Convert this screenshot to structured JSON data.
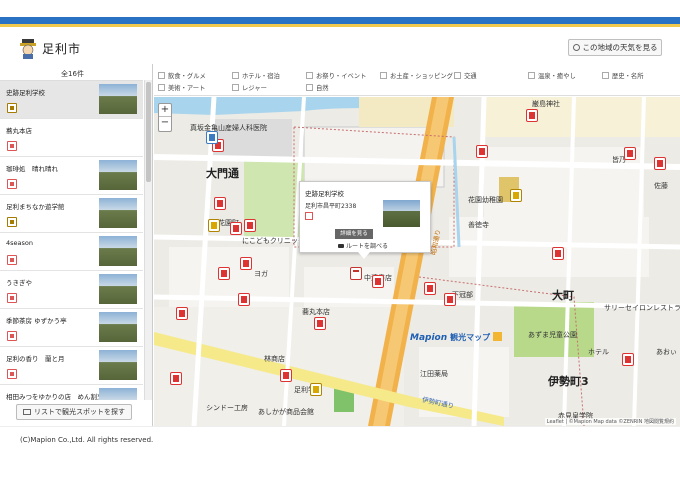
{
  "header": {
    "title": "足利市",
    "weather_button": "この地域の天気を見る"
  },
  "sidebar": {
    "count_label": "全16件",
    "items": [
      {
        "label": "史跡足利学校",
        "kind": "culture",
        "selected": true
      },
      {
        "label": "蕎丸本店",
        "kind": "food"
      },
      {
        "label": "珈琲処　晴れ晴れ",
        "kind": "food"
      },
      {
        "label": "足利まちなか遊学館",
        "kind": "culture"
      },
      {
        "label": "4season",
        "kind": "food"
      },
      {
        "label": "うきぎや",
        "kind": "food"
      },
      {
        "label": "季節茶房 ゆずかう亭",
        "kind": "food"
      },
      {
        "label": "足利の香り　蘭と月",
        "kind": "food"
      },
      {
        "label": "相田みつをゆかりの店　めん割烹なかや",
        "kind": "food"
      }
    ],
    "list_button": "リストで観光スポットを探す"
  },
  "filters": [
    {
      "label": "飲食・グルメ"
    },
    {
      "label": "ホテル・宿泊"
    },
    {
      "label": "お祭り・イベント"
    },
    {
      "label": "お土産・ショッピング"
    },
    {
      "label": "交通"
    },
    {
      "label": "温泉・癒やし"
    },
    {
      "label": "歴史・名所"
    },
    {
      "label": "美術・アート"
    },
    {
      "label": "レジャー"
    },
    {
      "label": "自然"
    }
  ],
  "map": {
    "zoom_in": "+",
    "zoom_out": "−",
    "popup": {
      "title": "史跡足利学校",
      "address": "足利市昌平町2338",
      "detail_button": "詳細を見る",
      "route_link": "ルートを調べる"
    },
    "labels": {
      "daimon": "大門通",
      "hospital": "真坂金亀山産婦人科医院",
      "clinic": "にこどもクリニック",
      "shrine": "巌島神社",
      "kindergarten": "花園幼稚園",
      "zentokuji": "善徳寺",
      "omachi": "大町",
      "ise": "伊勢町3",
      "park": "あずま児童公園",
      "sarei": "サリーセイロンレストラン",
      "showa": "昭和通り",
      "isemachi_road": "伊勢町通り",
      "shimizu": "清水公園",
      "hanazono_store": "花園町",
      "nakashimizu": "中清書店",
      "shimokunimura": "下冠部",
      "kyobashi": "蕎丸本店",
      "rinbashi": "林商店",
      "yukawa": "江田薬局",
      "sindou": "シンドー工房",
      "ashikaga_shopping": "あしかが商品会館",
      "akatsuki": "赤見皇学院",
      "hotel": "ホテル",
      "aoyama": "あおぃ",
      "sato": "佐藤",
      "minamo": "皆乃",
      "gakko": "足利学校",
      "yoga": "ヨガ",
      "sakuraya": "足利まちなか遊学館",
      "shinsaku": "真田宝医院",
      "hanaya": "花道具"
    },
    "attribution": "Leaflet | ©Mapion Map data ©ZENRIN 地図閲覧規約",
    "brand": "Mapion",
    "brand_sub": "観光マップ"
  },
  "footer": {
    "copyright": "(C)Mapion Co.,Ltd. All rights reserved."
  },
  "colors": {
    "accent_blue": "#2a73c4",
    "accent_yellow": "#f2c94c",
    "road_orange": "#f2b24b",
    "map_bg": "#ecebe6",
    "pin_red": "#d33"
  }
}
